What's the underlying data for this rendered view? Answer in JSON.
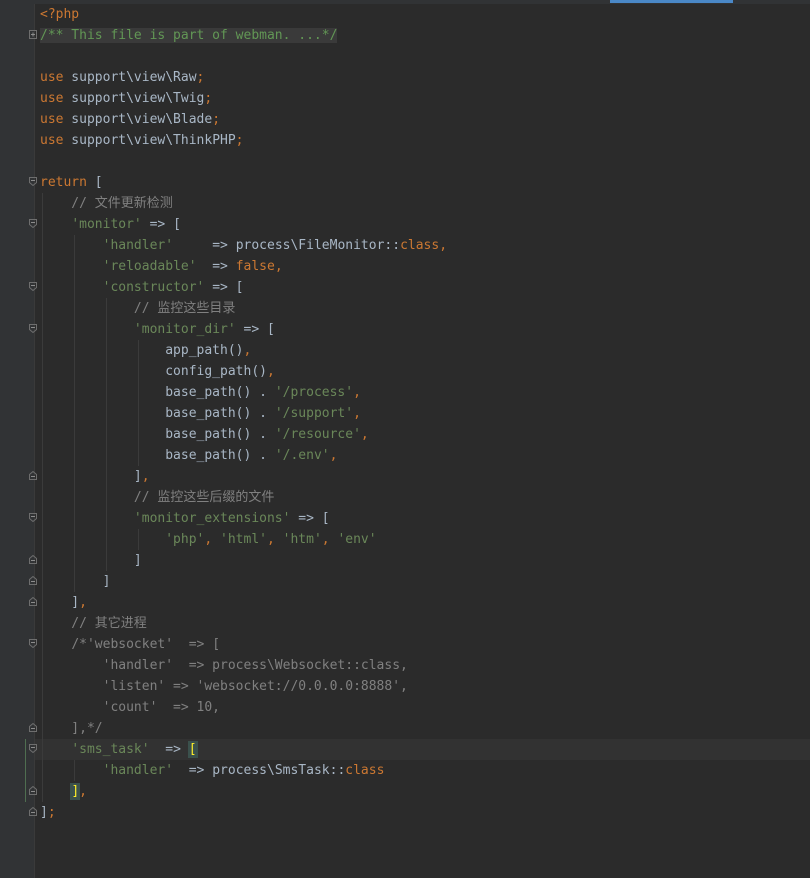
{
  "editor": {
    "language": "php",
    "code_lines": [
      "<?php",
      "/** This file is part of webman. ...*/",
      "",
      "use support\\view\\Raw;",
      "use support\\view\\Twig;",
      "use support\\view\\Blade;",
      "use support\\view\\ThinkPHP;",
      "",
      "return [",
      "    // 文件更新检测",
      "    'monitor' => [",
      "        'handler'     => process\\FileMonitor::class,",
      "        'reloadable'  => false,",
      "        'constructor' => [",
      "            // 监控这些目录",
      "            'monitor_dir' => [",
      "                app_path(),",
      "                config_path(),",
      "                base_path() . '/process',",
      "                base_path() . '/support',",
      "                base_path() . '/resource',",
      "                base_path() . '/.env',",
      "            ],",
      "            // 监控这些后缀的文件",
      "            'monitor_extensions' => [",
      "                'php', 'html', 'htm', 'env'",
      "            ]",
      "        ]",
      "    ],",
      "    // 其它进程",
      "    /*'websocket'  => [",
      "        'handler'  => process\\Websocket::class,",
      "        'listen' => 'websocket://0.0.0.0:8888',",
      "        'count'  => 10,",
      "    ],*/",
      "    'sms_task'  => [",
      "        'handler'  => process\\SmsTask::class",
      "    ],",
      "];"
    ]
  },
  "colors": {
    "background": "#2b2b2b",
    "gutter": "#313335",
    "keyword": "#cc7832",
    "string": "#6a8759",
    "comment": "#808080",
    "doc_comment": "#629755",
    "default_text": "#a9b7c6",
    "bracket_match": "#ffef28",
    "scroll_thumb": "#4a88c7"
  }
}
